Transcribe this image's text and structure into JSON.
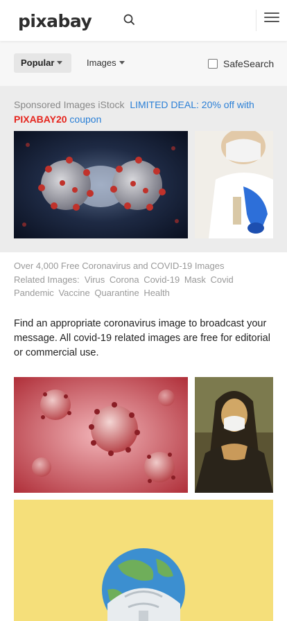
{
  "header": {
    "logo": "pixabay",
    "search_icon": "search-icon",
    "menu_icon": "hamburger-menu-icon"
  },
  "filters": {
    "sort_label": "Popular",
    "type_label": "Images",
    "safesearch_label": "SafeSearch",
    "safesearch_checked": false
  },
  "sponsored": {
    "prefix": "Sponsored Images iStock",
    "deal": "LIMITED DEAL: 20% off with",
    "code": "PIXABAY20",
    "suffix": "coupon"
  },
  "info": {
    "count_text": "Over 4,000 Free Coronavirus and COVID-19 Images",
    "related_label": "Related Images:",
    "related": [
      "Virus",
      "Corona",
      "Covid-19",
      "Mask",
      "Covid",
      "Pandemic",
      "Vaccine",
      "Quarantine",
      "Health"
    ],
    "description": "Find an appropriate coronavirus image to broadcast your message. All covid-19 related images are free for editorial or commercial use."
  },
  "colors": {
    "accent_link": "#2a7fd6",
    "coupon_red": "#e5241d",
    "filter_bg": "#f7f7f7",
    "sponsored_bg": "#ececec"
  }
}
